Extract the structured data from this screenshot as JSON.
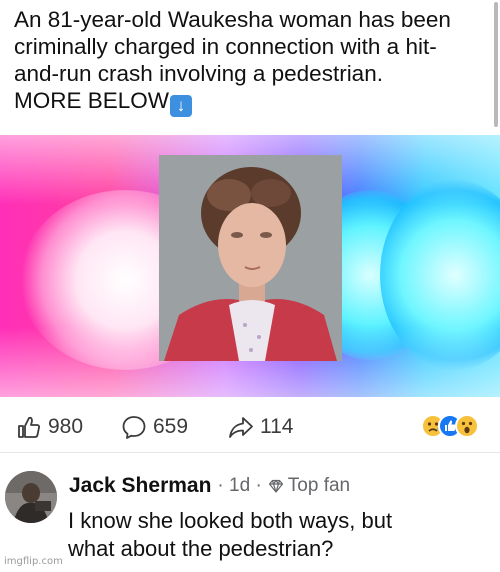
{
  "post": {
    "text_lines": [
      "An 81-year-old Waukesha woman has been",
      "criminally charged in connection with a hit-",
      "and-run crash involving a pedestrian."
    ],
    "more_label": "MORE BELOW",
    "more_emoji": "down-arrow-emoji"
  },
  "media": {
    "background_colors": [
      "#ff2fb8",
      "#c86bff",
      "#3c7bff",
      "#5de2ff"
    ],
    "photo_icon": "mugshot-photo"
  },
  "stats": {
    "likes": "980",
    "comments": "659",
    "shares": "114",
    "reaction_icons": [
      "sad-face-icon",
      "thumbs-up-icon",
      "wow-face-icon"
    ]
  },
  "comment": {
    "author": "Jack Sherman",
    "time": "· 1d ·",
    "badge": "Top fan",
    "badge_icon": "diamond-icon",
    "body_lines": [
      "I know she looked both ways, but",
      "what about the pedestrian?"
    ]
  },
  "watermark": "imgflip.com",
  "colors": {
    "like_blue": "#1877f2",
    "meta_gray": "#65676b",
    "emoji_yellow": "#f7c13c"
  }
}
